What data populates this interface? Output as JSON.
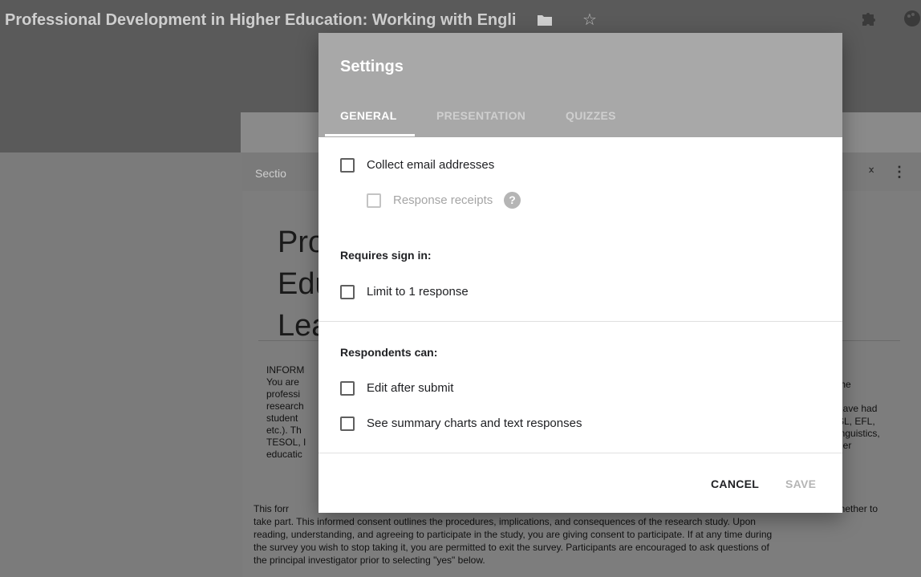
{
  "app": {
    "title": "Professional Development in Higher Education: Working with Engli",
    "folder_icon": "folder-icon",
    "star_icon": "star-icon",
    "addon_icon": "puzzle-icon",
    "palette_icon": "palette-icon"
  },
  "form": {
    "section_label": "Sectio",
    "title_lines": [
      "Pro",
      "Edu",
      "Lea"
    ],
    "text_lines": [
      "INFORM",
      "You are",
      "professi",
      "research",
      "student",
      "etc.). Th",
      "TESOL, I",
      "educatic"
    ],
    "right_text_lines": [
      "the",
      "",
      "have had",
      "SL, EFL,",
      "inguistics,",
      "her"
    ],
    "bottom_start": "This forr",
    "bottom_end": "whether to",
    "bottom_lines": [
      "take part. This informed consent outlines the procedures, implications, and consequences of the research study.  Upon",
      "reading, understanding, and agreeing to participate in the study, you are giving consent to participate. If at any time during",
      "the survey you wish to stop taking it, you are permitted to exit the survey.  Participants are encouraged to ask questions of",
      "the principal investigator prior to selecting \"yes\" below."
    ]
  },
  "dialog": {
    "title": "Settings",
    "tabs": {
      "general": "GENERAL",
      "presentation": "PRESENTATION",
      "quizzes": "QUIZZES",
      "active": "GENERAL"
    },
    "options": {
      "collect_email": {
        "label": "Collect email addresses",
        "checked": false
      },
      "response_receipts": {
        "label": "Response receipts",
        "checked": false,
        "disabled": true,
        "help": "?"
      },
      "requires_sign_in_heading": "Requires sign in:",
      "limit_one": {
        "label": "Limit to 1 response",
        "checked": false
      },
      "respondents_heading": "Respondents can:",
      "edit_after_submit": {
        "label": "Edit after submit",
        "checked": false
      },
      "see_summary": {
        "label": "See summary charts and text responses",
        "checked": false
      }
    },
    "buttons": {
      "cancel": "CANCEL",
      "save": "SAVE"
    }
  }
}
